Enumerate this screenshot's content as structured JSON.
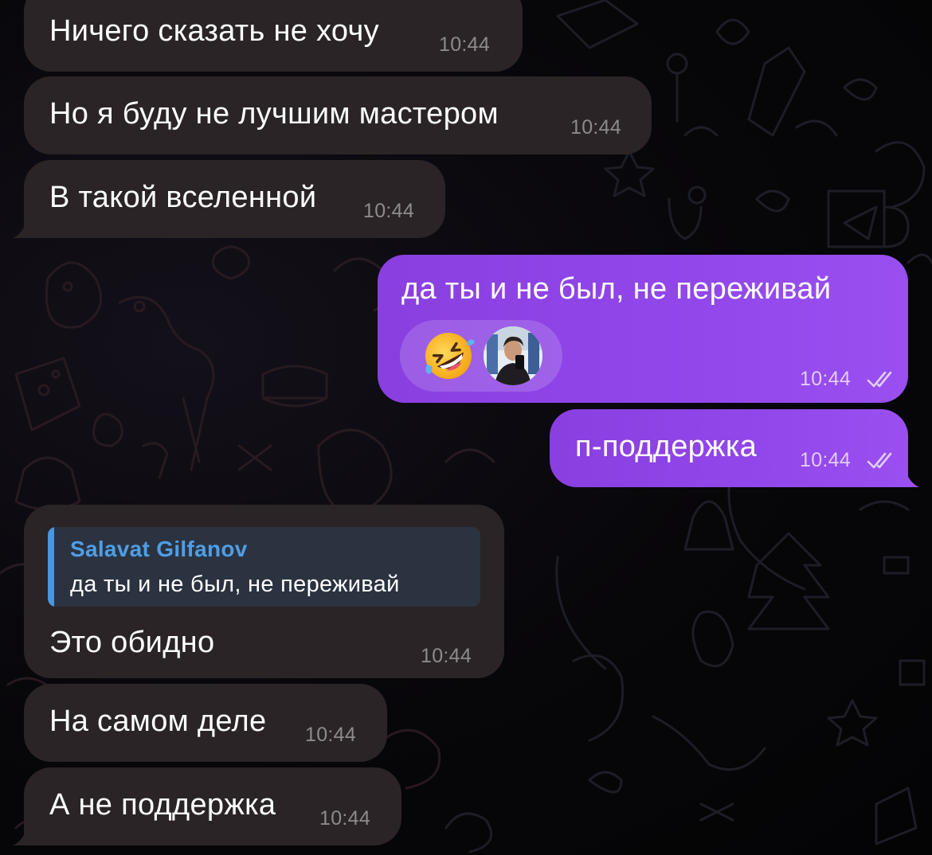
{
  "messages": [
    {
      "text": "Ничего сказать не хочу",
      "time": "10:44"
    },
    {
      "text": "Но я буду не лучшим мастером",
      "time": "10:44"
    },
    {
      "text": "В такой вселенной",
      "time": "10:44"
    },
    {
      "text": "да ты и не был, не переживай",
      "time": "10:44",
      "reaction_emoji": "rolling-on-floor-laughing",
      "reactor_avatar": "avatar"
    },
    {
      "text": "п-поддержка",
      "time": "10:44"
    },
    {
      "reply_author": "Salavat Gilfanov",
      "reply_text": "да ты и не был, не переживай",
      "text": "Это обидно",
      "time": "10:44"
    },
    {
      "text": "На самом деле",
      "time": "10:44"
    },
    {
      "text": "А не поддержка",
      "time": "10:44"
    }
  ],
  "colors": {
    "incoming_bubble": "#2a2426",
    "outgoing_bubble": "#9147ea",
    "reply_accent": "#4a96e0"
  },
  "icons": {
    "read_receipt": "double-check-icon"
  }
}
